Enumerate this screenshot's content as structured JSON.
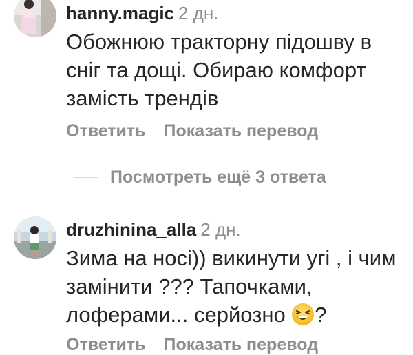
{
  "comments": [
    {
      "username": "hanny.magic",
      "time": "2 дн.",
      "text": "Обожнюю тракторну підошву в сніг та дощі. Обираю комфорт замість трендів",
      "reply_label": "Ответить",
      "translate_label": "Показать перевод"
    },
    {
      "username": "druzhinina_alla",
      "time": "2 дн.",
      "text_before_emoji": "Зима на носі)) викинути угі , і чим замінити ??? Тапочками, лоферами... серйозно ",
      "emoji": "grinning-squinting-face",
      "text_after_emoji": "?",
      "reply_label": "Ответить",
      "translate_label": "Показать перевод"
    }
  ],
  "view_replies_label": "Посмотреть ещё 3 ответа",
  "colors": {
    "text": "#262626",
    "secondary": "#8e8e8e",
    "divider": "#dbdbdb"
  }
}
